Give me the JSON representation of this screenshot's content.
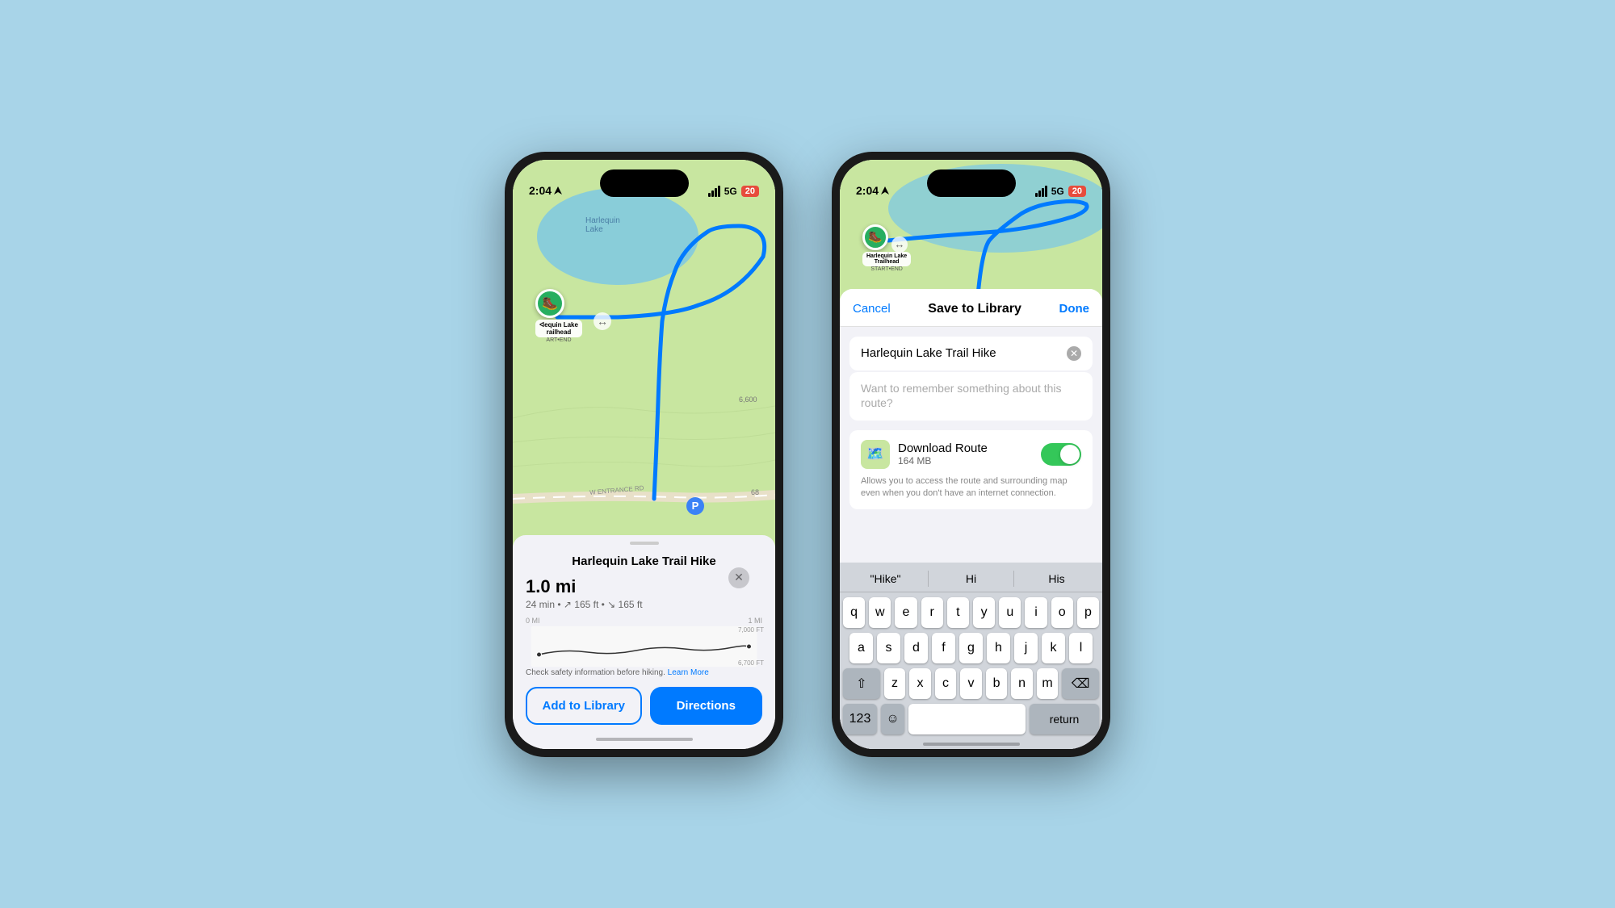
{
  "background": "#a8d4e8",
  "phone1": {
    "status": {
      "time": "2:04",
      "signal": "5G",
      "battery": "20"
    },
    "map": {
      "lake_label": "Harlequin\nLake",
      "road_label": "W ENTRANCE RD",
      "elevation_label": "6,600"
    },
    "trailhead": {
      "name": "equin Lake\nrailhead",
      "sub": "ART•END"
    },
    "sheet": {
      "title": "Harlequin Lake Trail Hike",
      "distance": "1.0 mi",
      "details": "24 min  •  ↗ 165 ft  •  ↘ 165 ft",
      "elevation_high": "7,000 FT",
      "elevation_low": "6,700 FT",
      "chart_left": "0 MI",
      "chart_right": "1 MI",
      "safety_text": "Check safety information before hiking.",
      "learn_more": "Learn More",
      "btn_library": "Add to Library",
      "btn_directions": "Directions"
    }
  },
  "phone2": {
    "status": {
      "time": "2:04",
      "signal": "5G",
      "battery": "20"
    },
    "save_sheet": {
      "cancel": "Cancel",
      "title": "Save to Library",
      "done": "Done",
      "route_name": "Harlequin Lake Trail Hike",
      "notes_placeholder": "Want to remember something about this route?",
      "download_title": "Download Route",
      "download_size": "164 MB",
      "download_desc": "Allows you to access the route and surrounding map even when you don't have an internet connection."
    },
    "keyboard": {
      "suggestions": [
        "\"Hike\"",
        "Hi",
        "His"
      ],
      "row1": [
        "q",
        "w",
        "e",
        "r",
        "t",
        "y",
        "u",
        "i",
        "o",
        "p"
      ],
      "row2": [
        "a",
        "s",
        "d",
        "f",
        "g",
        "h",
        "j",
        "k",
        "l"
      ],
      "row3": [
        "z",
        "x",
        "c",
        "v",
        "b",
        "n",
        "m"
      ],
      "num_label": "123",
      "return_label": "return"
    }
  }
}
